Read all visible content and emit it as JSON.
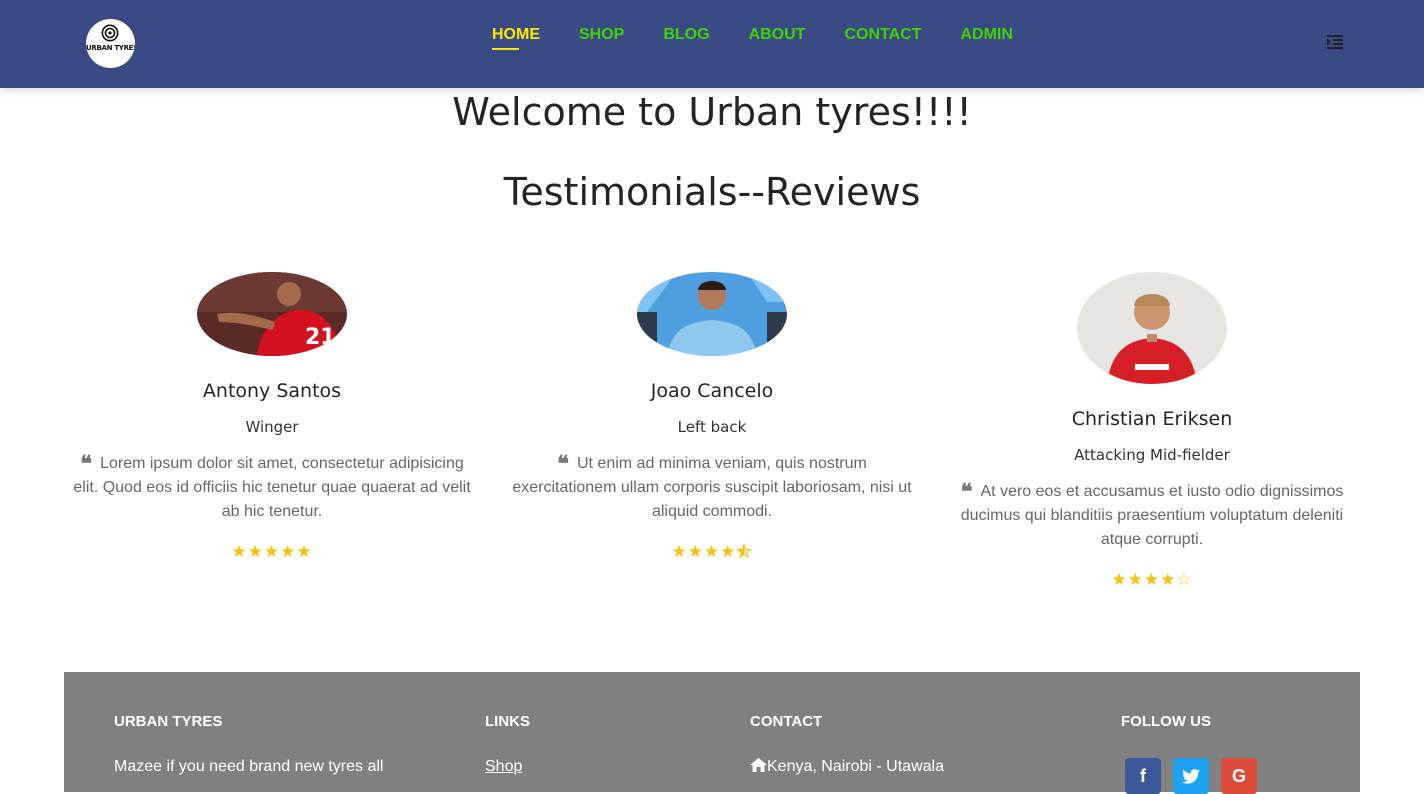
{
  "brand": {
    "logo_text": "URBAN TYRES"
  },
  "nav": {
    "items": [
      {
        "label": "HOME",
        "active": true
      },
      {
        "label": "SHOP",
        "active": false
      },
      {
        "label": "BLOG",
        "active": false
      },
      {
        "label": "ABOUT",
        "active": false
      },
      {
        "label": "CONTACT",
        "active": false
      },
      {
        "label": "ADMIN",
        "active": false
      }
    ],
    "active_color": "#fbe700",
    "link_color": "#3fd400",
    "bar_color": "#3a4a84"
  },
  "welcome": "Welcome to Urban tyres!!!!",
  "testimonials_title": "Testimonials--Reviews",
  "testimonials": [
    {
      "name": "Antony Santos",
      "role": "Winger",
      "quote": "Lorem ipsum dolor sit amet, consectetur adipisicing elit. Quod eos id officiis hic tenetur quae quaerat ad velit ab hic tenetur.",
      "rating": 5
    },
    {
      "name": "Joao Cancelo",
      "role": "Left back",
      "quote": "Ut enim ad minima veniam, quis nostrum exercitationem ullam corporis suscipit laboriosam, nisi ut aliquid commodi.",
      "rating": 4.5
    },
    {
      "name": "Christian Eriksen",
      "role": "Attacking Mid-fielder",
      "quote": "At vero eos et accusamus et iusto odio dignissimos ducimus qui blanditiis praesentium voluptatum deleniti atque corrupti.",
      "rating": 4
    }
  ],
  "footer": {
    "about": {
      "heading": "URBAN TYRES",
      "text": "Mazee if you need brand new tyres all"
    },
    "links": {
      "heading": "LINKS",
      "items": [
        "Shop"
      ]
    },
    "contact": {
      "heading": "CONTACT",
      "address": "Kenya, Nairobi - Utawala"
    },
    "follow": {
      "heading": "FOLLOW US",
      "icons": [
        "facebook-icon",
        "twitter-icon",
        "google-icon"
      ]
    },
    "background": "#808080"
  },
  "star_color": "#fbbf0d"
}
